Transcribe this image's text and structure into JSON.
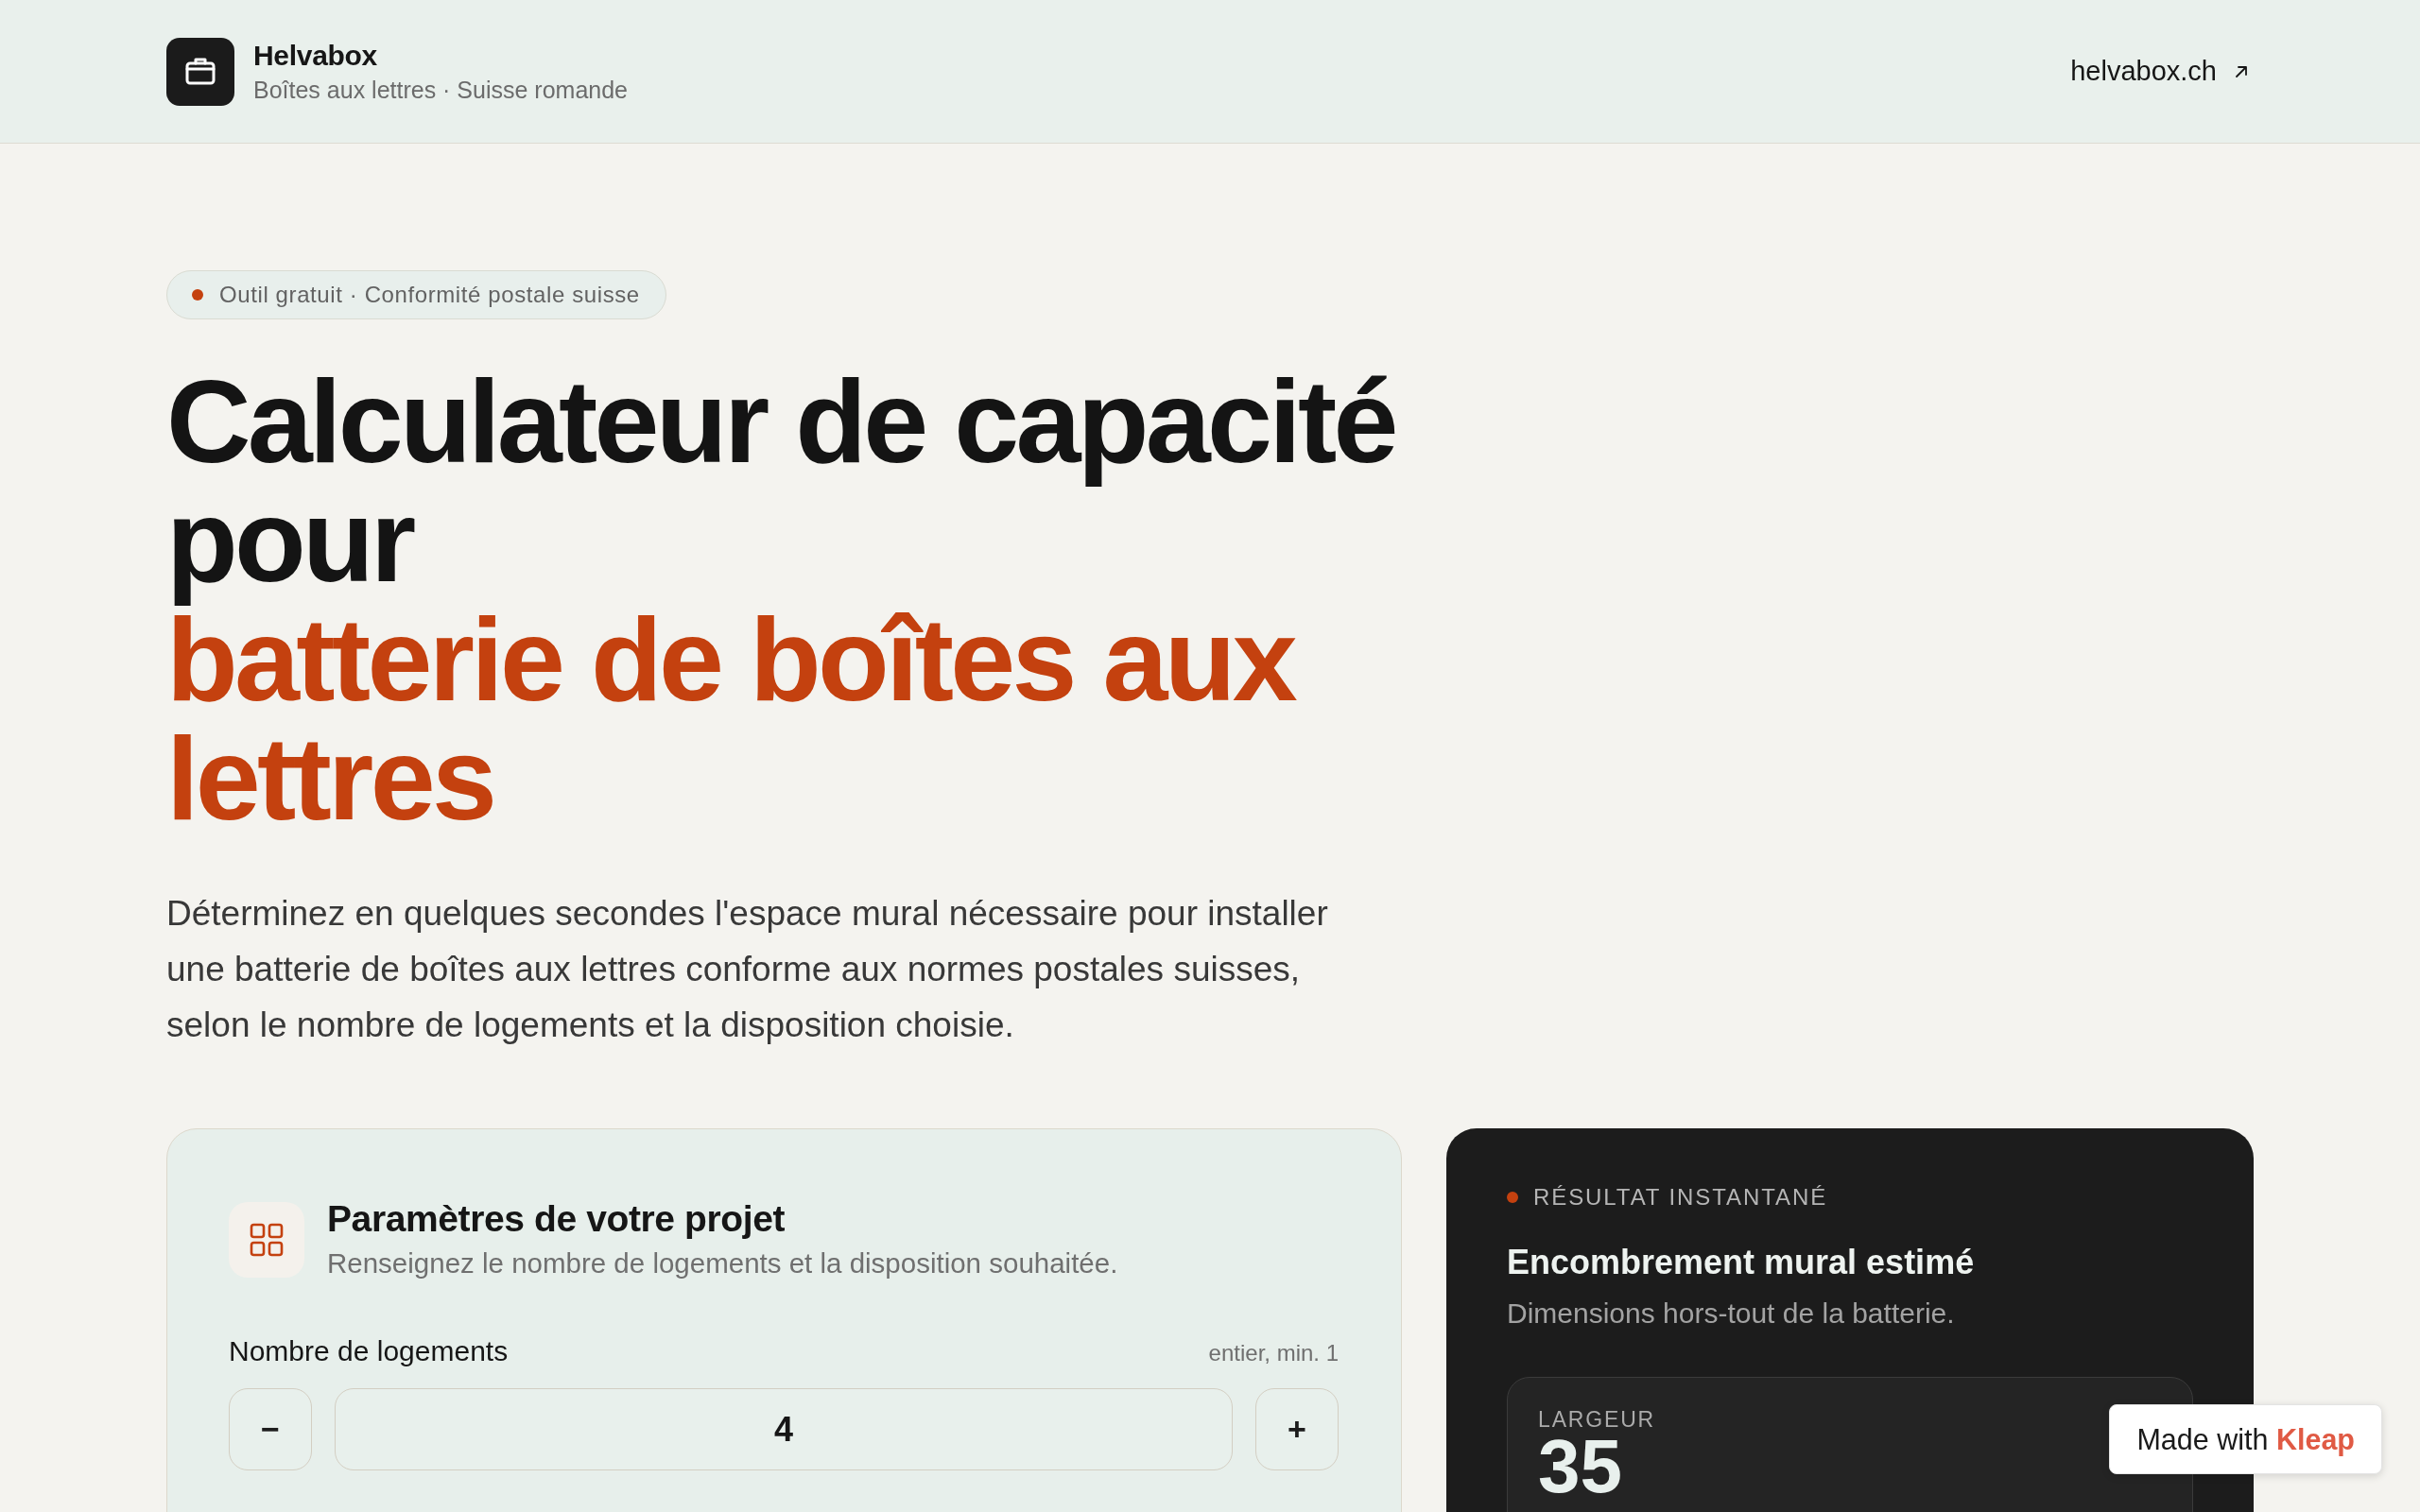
{
  "header": {
    "brand_name": "Helvabox",
    "brand_tagline": "Boîtes aux lettres · Suisse romande",
    "site_link": "helvabox.ch"
  },
  "hero": {
    "badge": "Outil gratuit · Conformité postale suisse",
    "title": "Calculateur de capacité pour",
    "title_highlight": "batterie de boîtes aux lettres",
    "intro": "Déterminez en quelques secondes l'espace mural nécessaire pour installer une batterie de boîtes aux lettres conforme aux normes postales suisses, selon le nombre de logements et la disposition choisie."
  },
  "parameters": {
    "title": "Paramètres de votre projet",
    "subtitle": "Renseignez le nombre de logements et la disposition souhaitée.",
    "housing_count": {
      "label": "Nombre de logements",
      "hint": "entier, min. 1",
      "value": "4",
      "decrement": "−",
      "increment": "+"
    }
  },
  "result": {
    "eyebrow": "RÉSULTAT INSTANTANÉ",
    "title": "Encombrement mural estimé",
    "subtitle": "Dimensions hors-tout de la batterie.",
    "metrics": [
      {
        "label": "LARGEUR",
        "value": "35"
      }
    ]
  },
  "builder_badge": "Made with **Kleap**"
}
